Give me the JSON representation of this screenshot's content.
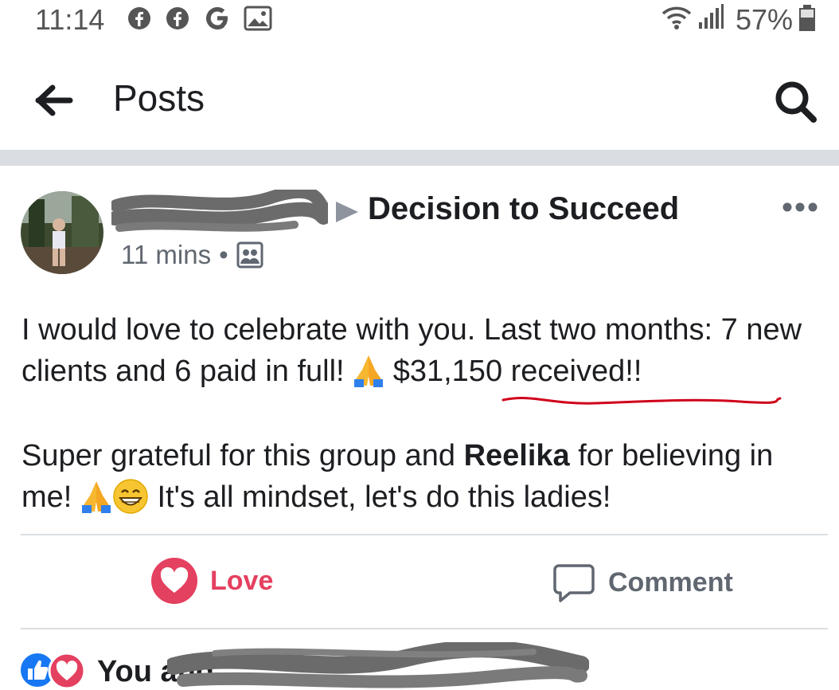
{
  "status_bar": {
    "time": "11:14",
    "battery": "57%"
  },
  "header": {
    "title": "Posts"
  },
  "post": {
    "group": "Decision to Succeed",
    "time": "11 mins",
    "dot": "•",
    "paragraph1": {
      "part1": "I would love to celebrate with you. Last two months: 7 new clients and 6 paid in full! ",
      "part2": " $31,150 received!!"
    },
    "paragraph2": {
      "part1": "Super grateful for this group and ",
      "mention": "Reelika",
      "part2": " for believing in me! ",
      "part3": " It's all mindset, let's do this ladies!"
    }
  },
  "actions": {
    "love": "Love",
    "comment": "Comment"
  },
  "reactions": {
    "text": "You and"
  },
  "colors": {
    "love": "#e4405f",
    "like": "#1877f2",
    "underline": "#d0021b"
  }
}
